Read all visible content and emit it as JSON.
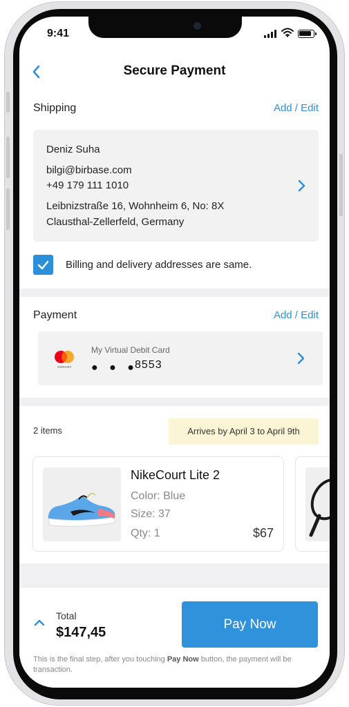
{
  "status_bar": {
    "time": "9:41"
  },
  "header": {
    "title": "Secure Payment"
  },
  "shipping": {
    "title": "Shipping",
    "edit_label": "Add / Edit",
    "name": "Deniz Suha",
    "email": "bilgi@birbase.com",
    "phone": "+49 179 111 1010",
    "address_line1": "Leibnizstraße 16, Wohnheim 6, No: 8X",
    "address_line2": "Clausthal-Zellerfeld, Germany"
  },
  "billing_same": {
    "checked": true,
    "label": "Billing and delivery addresses are same."
  },
  "payment": {
    "title": "Payment",
    "edit_label": "Add / Edit",
    "card_name": "My Virtual Debit Card",
    "masked_dots": "● ● ●",
    "last4": "8553",
    "brand_text": "mastercard"
  },
  "items": {
    "count": "2 items",
    "arrival": "Arrives by April 3 to April 9th",
    "products": [
      {
        "name": "NikeCourt Lite 2",
        "color": "Color: Blue",
        "size": "Size: 37",
        "qty": "Qty: 1",
        "price": "$67"
      }
    ]
  },
  "checkout": {
    "total_label": "Total",
    "total_value": "$147,45",
    "pay_button": "Pay Now",
    "note_prefix": "This is the final step, after you touching",
    "note_bold": "Pay Now",
    "note_suffix": "button, the payment will be transaction."
  },
  "colors": {
    "accent": "#2f92db",
    "link": "#2b8fd9",
    "arrival_bg": "#fbf5d5",
    "card_bg": "#f2f2f3"
  }
}
